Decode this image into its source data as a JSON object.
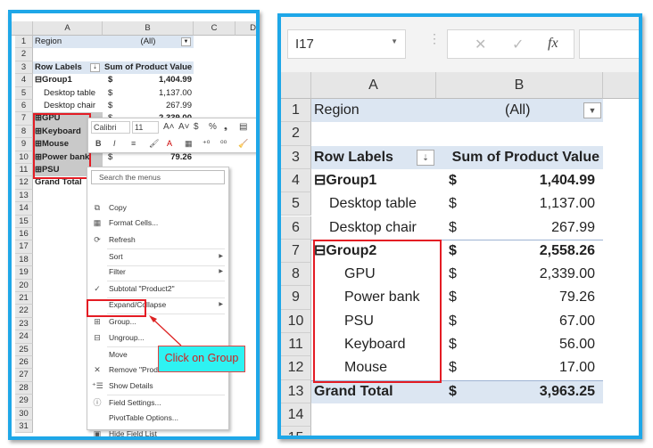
{
  "left": {
    "columns": [
      "A",
      "B",
      "C",
      "D"
    ],
    "rows": [
      {
        "n": "1",
        "a": "Region",
        "cur": "",
        "val": "(All)",
        "style": "filter"
      },
      {
        "n": "2",
        "a": "",
        "cur": "",
        "val": ""
      },
      {
        "n": "3",
        "a": "Row Labels",
        "cur": "",
        "val": "Sum of Product Value",
        "style": "header"
      },
      {
        "n": "4",
        "a": "⊟Group1",
        "cur": "$",
        "val": "1,404.99",
        "style": "bold"
      },
      {
        "n": "5",
        "a": "Desktop table",
        "cur": "$",
        "val": "1,137.00",
        "style": "indent"
      },
      {
        "n": "6",
        "a": "Desktop chair",
        "cur": "$",
        "val": "267.99",
        "style": "indent"
      },
      {
        "n": "7",
        "a": "⊞GPU",
        "cur": "$",
        "val": "2,339.00",
        "style": "sel"
      },
      {
        "n": "8",
        "a": "⊞Keyboard",
        "cur": "",
        "val": "",
        "style": "sel"
      },
      {
        "n": "9",
        "a": "⊞Mouse",
        "cur": "",
        "val": "",
        "style": "sel"
      },
      {
        "n": "10",
        "a": "⊞Power bank",
        "cur": "$",
        "val": "79.26",
        "style": "sel"
      },
      {
        "n": "11",
        "a": "⊞PSU",
        "cur": "",
        "val": "",
        "style": "sel"
      },
      {
        "n": "12",
        "a": "Grand Total",
        "cur": "",
        "val": "",
        "style": "bold"
      }
    ],
    "row_count": 31,
    "mini_toolbar": {
      "font": "Calibri",
      "size": "11",
      "row1_icons": [
        "A˄",
        "A˅",
        "$",
        "%",
        "❟",
        "▤"
      ],
      "row2_icons": [
        "B",
        "I",
        "≡",
        "🖌",
        "A",
        "▦",
        "⁺⁰",
        "⁰⁰",
        "🧹"
      ]
    },
    "menu": {
      "search_placeholder": "Search the menus",
      "items": [
        {
          "label": "Copy",
          "icon": "⧉",
          "icon_name": "copy-icon"
        },
        {
          "label": "Format Cells...",
          "icon": "▦",
          "icon_name": "format-cells-icon"
        },
        {
          "label": "Refresh",
          "icon": "⟳",
          "icon_name": "refresh-icon",
          "sep": true
        },
        {
          "label": "Sort",
          "submenu": true,
          "sep": true
        },
        {
          "label": "Filter",
          "submenu": true,
          "sep": true
        },
        {
          "label": "Subtotal \"Product2\"",
          "icon": "✓",
          "icon_name": "check-icon",
          "sep": true
        },
        {
          "label": "Expand/Collapse",
          "submenu": true,
          "sep": true
        },
        {
          "label": "Group...",
          "icon": "⊞",
          "icon_name": "group-icon"
        },
        {
          "label": "Ungroup...",
          "icon": "⊟",
          "icon_name": "ungroup-icon",
          "sep": true
        },
        {
          "label": "Move",
          "submenu": true
        },
        {
          "label": "Remove \"Product2\"",
          "icon": "✕",
          "icon_name": "remove-icon"
        },
        {
          "label": "Show Details",
          "icon": "⁺☰",
          "icon_name": "show-details-icon",
          "sep": true
        },
        {
          "label": "Field Settings...",
          "icon": "ⓘ",
          "icon_name": "field-settings-icon"
        },
        {
          "label": "PivotTable Options..."
        },
        {
          "label": "Hide Field List",
          "icon": "▣",
          "icon_name": "field-list-icon"
        }
      ]
    },
    "callout": "Click on Group"
  },
  "right": {
    "name_box": "I17",
    "formula_icons": {
      "cancel": "✕",
      "enter": "✓",
      "function": "fx"
    },
    "columns": [
      "A",
      "B"
    ],
    "rows": [
      {
        "n": "1",
        "a": "Region",
        "cur": "",
        "val": "(All)",
        "style": "filter"
      },
      {
        "n": "2",
        "a": "",
        "cur": "",
        "val": ""
      },
      {
        "n": "3",
        "a": "Row Labels",
        "cur": "",
        "val": "Sum of Product Value",
        "style": "header"
      },
      {
        "n": "4",
        "a": "⊟Group1",
        "cur": "$",
        "val": "1,404.99",
        "style": "bold"
      },
      {
        "n": "5",
        "a": "Desktop table",
        "cur": "$",
        "val": "1,137.00",
        "style": "indent"
      },
      {
        "n": "6",
        "a": "Desktop chair",
        "cur": "$",
        "val": "267.99",
        "style": "indent"
      },
      {
        "n": "7",
        "a": "⊟Group2",
        "cur": "$",
        "val": "2,558.26",
        "style": "bold"
      },
      {
        "n": "8",
        "a": "GPU",
        "cur": "$",
        "val": "2,339.00",
        "style": "indent2"
      },
      {
        "n": "9",
        "a": "Power bank",
        "cur": "$",
        "val": "79.26",
        "style": "indent2"
      },
      {
        "n": "10",
        "a": "PSU",
        "cur": "$",
        "val": "67.00",
        "style": "indent2"
      },
      {
        "n": "11",
        "a": "Keyboard",
        "cur": "$",
        "val": "56.00",
        "style": "indent2"
      },
      {
        "n": "12",
        "a": "Mouse",
        "cur": "$",
        "val": "17.00",
        "style": "indent2"
      },
      {
        "n": "13",
        "a": "Grand Total",
        "cur": "$",
        "val": "3,963.25",
        "style": "total"
      },
      {
        "n": "14",
        "a": "",
        "cur": "",
        "val": ""
      },
      {
        "n": "15",
        "a": "",
        "cur": "",
        "val": ""
      }
    ]
  },
  "colors": {
    "frame": "#1ea7e8",
    "highlight": "#e41c24",
    "callout_bg": "#2ef2f2",
    "pivot_header": "#dce6f2"
  }
}
